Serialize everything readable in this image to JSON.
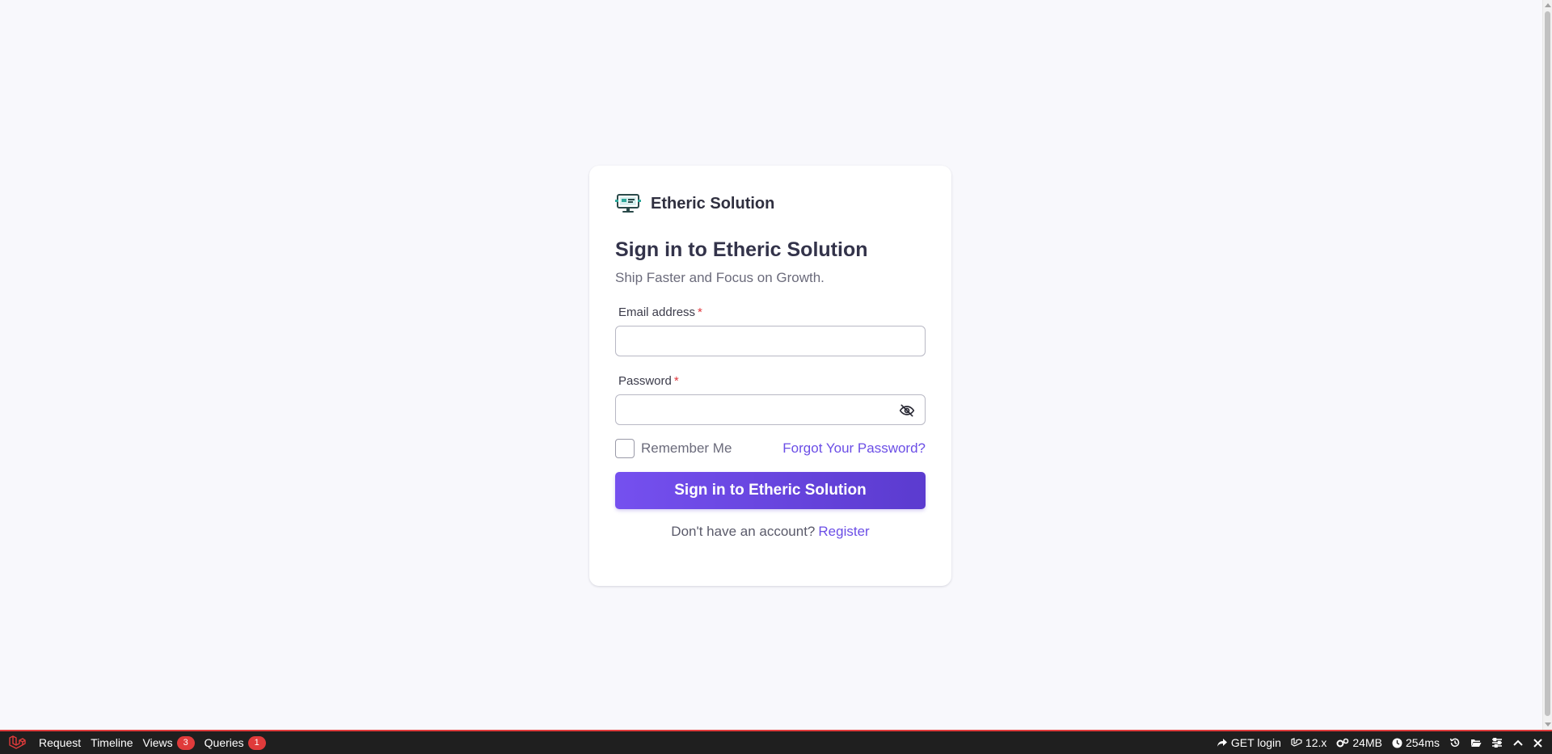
{
  "brand": {
    "name": "Etheric Solution",
    "logo": "monitor-logo-icon"
  },
  "heading": {
    "title": "Sign in to Etheric Solution",
    "subtitle": "Ship Faster and Focus on Growth."
  },
  "form": {
    "email_label": "Email address",
    "password_label": "Password",
    "required_mark": "*",
    "email_value": "",
    "password_value": "",
    "remember_label": "Remember Me",
    "remember_checked": false,
    "forgot_link": "Forgot Your Password?",
    "submit_label": "Sign in to Etheric Solution",
    "register_prompt": "Don't have an account?",
    "register_link": "Register"
  },
  "debugbar": {
    "tabs": [
      {
        "label": "Request"
      },
      {
        "label": "Timeline"
      },
      {
        "label": "Views",
        "badge": "3"
      },
      {
        "label": "Queries",
        "badge": "1"
      }
    ],
    "status": {
      "route": "GET login",
      "version": "12.x",
      "memory": "24MB",
      "time": "254ms"
    }
  },
  "colors": {
    "accent": "#6b4ee6",
    "button_start": "#7550ef",
    "button_end": "#5b3bcf",
    "required": "#e0383e",
    "debug_badge": "#e03b3b",
    "page_bg": "#f8f8fc"
  }
}
